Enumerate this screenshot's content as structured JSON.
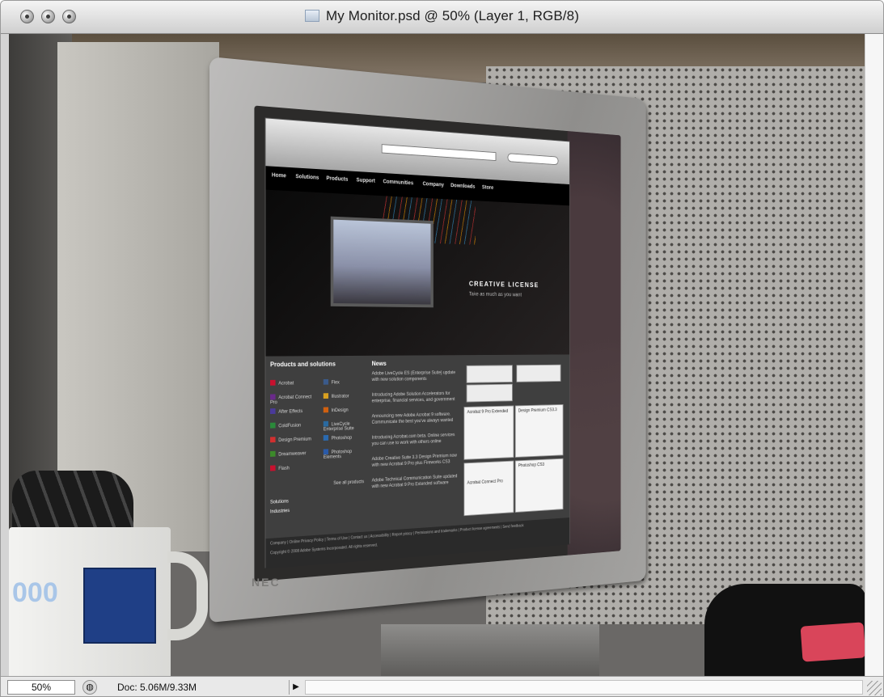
{
  "window": {
    "title": "My Monitor.psd @ 50% (Layer 1, RGB/8)"
  },
  "status": {
    "zoom": "50%",
    "doc_info": "Doc: 5.06M/9.33M"
  },
  "photo": {
    "monitor_brand": "NEC",
    "screen": {
      "nav": [
        "Home",
        "Solutions",
        "Products",
        "Support",
        "Communities",
        "Company",
        "Downloads",
        "Store"
      ],
      "hero_title": "CREATIVE LICENSE",
      "hero_subtitle": "Take as much as you want",
      "products_heading": "Products and solutions",
      "products_col1": [
        "Acrobat",
        "Acrobat Connect Pro",
        "After Effects",
        "ColdFusion",
        "Design Premium",
        "Dreamweaver",
        "Flash"
      ],
      "products_col2": [
        "Flex",
        "Illustrator",
        "InDesign",
        "LiveCycle Enterprise Suite",
        "Photoshop",
        "Photoshop Elements"
      ],
      "products_colors": [
        "#c8102e",
        "#6a2a8a",
        "#4a3a9a",
        "#2a8a3a",
        "#d22f2f",
        "#3c8a2a",
        "#c8102e",
        "#3a5a8a",
        "#d8a020",
        "#d06010",
        "#2a6aa0",
        "#2a6ab0",
        "#2a5aa8"
      ],
      "see_all": "See all products",
      "side_links": [
        "Solutions",
        "Industries"
      ],
      "news_heading": "News",
      "news_items": [
        "Adobe LiveCycle ES (Enterprise Suite) update with new solution components",
        "Introducing Adobe Solution Accelerators for enterprise, financial services, and government",
        "Announcing new Adobe Acrobat 9 software. Communicate the best you've always wanted",
        "Introducing Acrobat.com beta. Online services you can use to work with others online",
        "Adobe Creative Suite 3.3 Design Premium now with new Acrobat 9 Pro plus Fireworks CS3",
        "Adobe Technical Communication Suite updated with new Acrobat 9 Pro Extended software"
      ],
      "card_titles": [
        "Acrobat 9 Pro Extended",
        "Design Premium CS3.3",
        "Acrobat Connect Pro",
        "Photoshop CS3"
      ],
      "footer_links": "Company | Online Privacy Policy | Terms of Use | Contact us | Accessibility | Report piracy | Permissions and trademarks | Product license agreements | Send feedback",
      "footer_copy": "Copyright © 2008 Adobe Systems Incorporated. All rights reserved."
    },
    "mug_text": "000"
  }
}
